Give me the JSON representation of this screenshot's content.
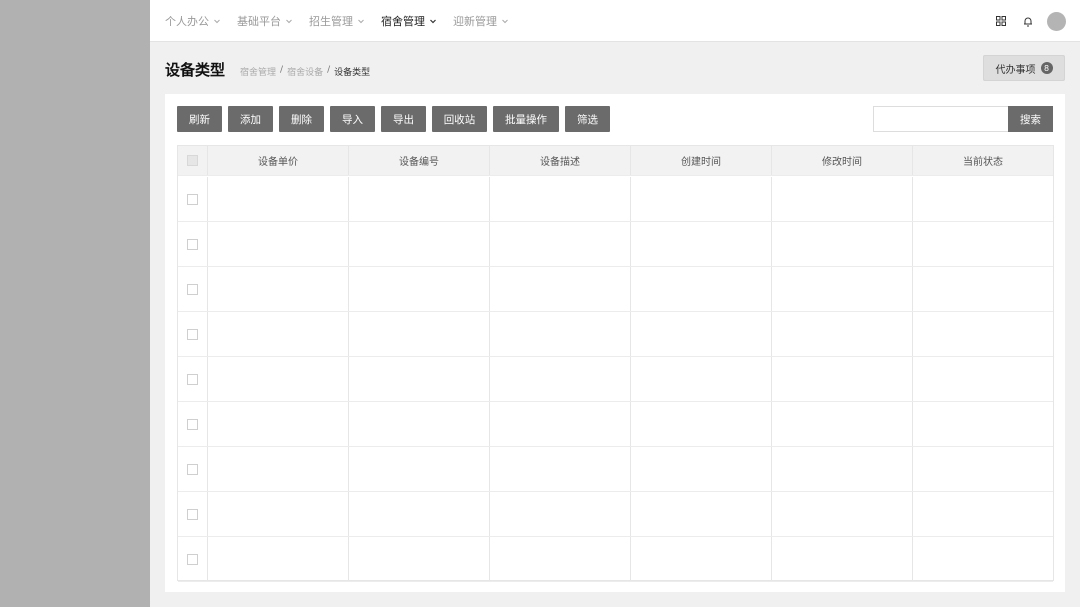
{
  "nav": {
    "items": [
      {
        "label": "个人办公",
        "active": false
      },
      {
        "label": "基础平台",
        "active": false
      },
      {
        "label": "招生管理",
        "active": false
      },
      {
        "label": "宿舍管理",
        "active": true
      },
      {
        "label": "迎新管理",
        "active": false
      }
    ],
    "icons": [
      "apps-grid-icon",
      "bell-icon",
      "avatar"
    ]
  },
  "page": {
    "title": "设备类型",
    "breadcrumb": [
      "宿舍管理",
      "宿舍设备",
      "设备类型"
    ],
    "todo_label": "代办事项",
    "todo_count": "8"
  },
  "toolbar": {
    "buttons": [
      "刷新",
      "添加",
      "删除",
      "导入",
      "导出",
      "回收站",
      "批量操作",
      "筛选"
    ],
    "search_value": "",
    "search_label": "搜索"
  },
  "table": {
    "columns": [
      "设备单价",
      "设备编号",
      "设备描述",
      "创建时间",
      "修改时间",
      "当前状态"
    ],
    "row_count": 9
  },
  "colors": {
    "sidebar": "#b1b1b1",
    "button": "#6b6b6b",
    "background": "#f0f0f0"
  }
}
